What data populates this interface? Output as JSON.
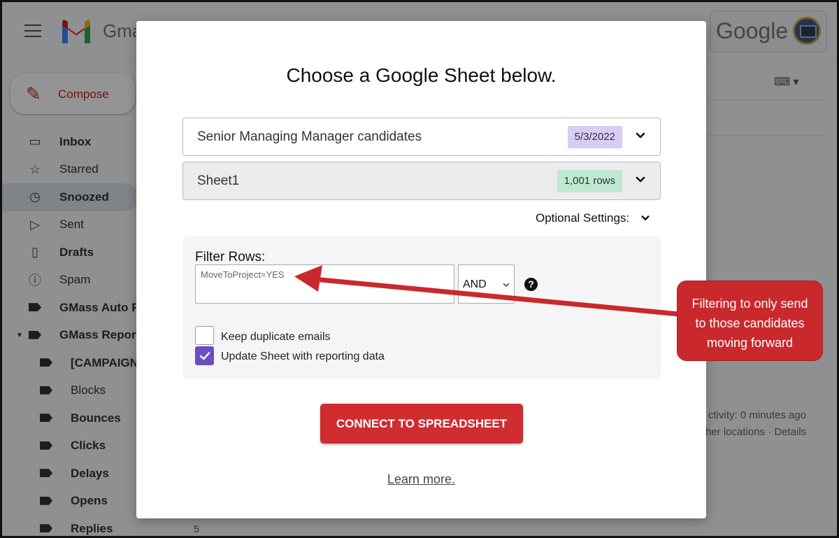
{
  "gmail": {
    "brand": "Gmail",
    "google_label": "Google",
    "compose_label": "Compose",
    "nav_items": [
      {
        "label": "Inbox",
        "icon": "inbox-icon"
      },
      {
        "label": "Starred",
        "icon": "star-icon"
      },
      {
        "label": "Snoozed",
        "icon": "clock-icon"
      },
      {
        "label": "Sent",
        "icon": "send-icon"
      },
      {
        "label": "Drafts",
        "icon": "draft-icon"
      },
      {
        "label": "Spam",
        "icon": "spam-icon"
      },
      {
        "label": "GMass Auto F",
        "icon": "label-icon"
      },
      {
        "label": "GMass Report",
        "icon": "label-icon"
      },
      {
        "label": "[CAMPAIGN",
        "icon": "label-icon"
      },
      {
        "label": "Blocks",
        "icon": "label-icon"
      },
      {
        "label": "Bounces",
        "icon": "label-icon"
      },
      {
        "label": "Clicks",
        "icon": "label-icon"
      },
      {
        "label": "Delays",
        "icon": "label-icon"
      },
      {
        "label": "Opens",
        "icon": "label-icon"
      },
      {
        "label": "Replies",
        "icon": "label-icon"
      }
    ],
    "replies_count": "5",
    "activity_text": "ctivity: 0 minutes ago",
    "details_text": "her locations · Details"
  },
  "modal": {
    "title": "Choose a Google Sheet below.",
    "sheet_name": "Senior Managing Manager candidates",
    "sheet_date": "5/3/2022",
    "tab_name": "Sheet1",
    "tab_rows": "1,001 rows",
    "optional_settings": "Optional Settings:",
    "filter_label": "Filter Rows:",
    "filter_value": "MoveToProject=YES",
    "operator": "AND",
    "help": "?",
    "keep_duplicates_label": "Keep duplicate emails",
    "update_sheet_label": "Update Sheet with reporting data",
    "connect_button": "CONNECT TO SPREADSHEET",
    "learn_more": "Learn more."
  },
  "annotation": {
    "line1": "Filtering to only send",
    "line2": "to those candidates",
    "line3": "moving forward"
  },
  "colors": {
    "accent_red": "#d12c2f",
    "date_badge": "#d7cdf5",
    "rows_badge": "#bfe8d2",
    "checkbox_purple": "#6a4fc2"
  },
  "state": {
    "keep_duplicates_checked": false,
    "update_sheet_checked": true
  }
}
